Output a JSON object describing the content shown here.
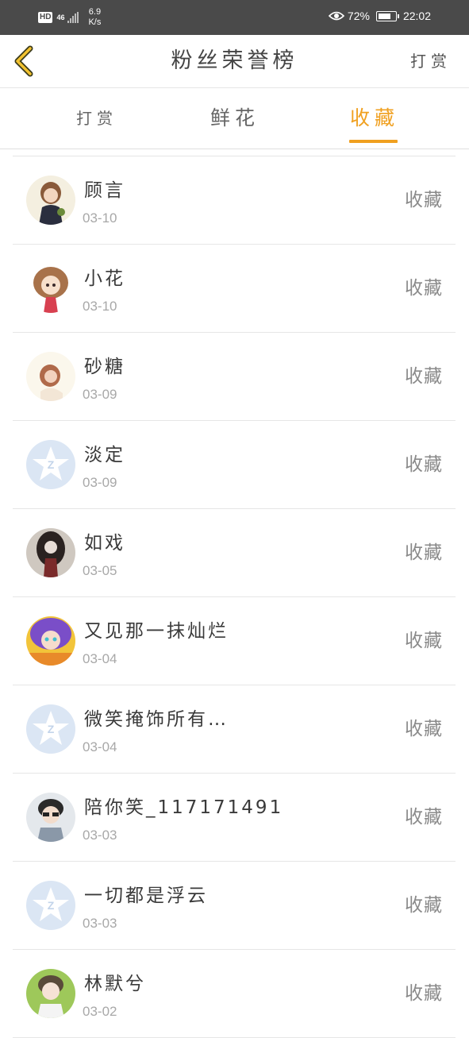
{
  "status_bar": {
    "hd_badge": "HD",
    "network": "46",
    "speed_value": "6.9",
    "speed_unit": "K/s",
    "battery": "72%",
    "time": "22:02"
  },
  "header": {
    "title": "粉丝荣誉榜",
    "action_label": "打赏"
  },
  "tabs": [
    {
      "label": "打赏",
      "active": false
    },
    {
      "label": "鲜花",
      "active": false
    },
    {
      "label": "收藏",
      "active": true
    }
  ],
  "colors": {
    "accent": "#f0a020",
    "status_bar": "#4a4a4a",
    "default_avatar": "#dbe6f4"
  },
  "entries": [
    {
      "name": "顾言",
      "date": "03-10",
      "action": "收藏",
      "avatar": "girl-brown-hair-avatar"
    },
    {
      "name": "小花",
      "date": "03-10",
      "action": "收藏",
      "avatar": "chibi-girl-avatar"
    },
    {
      "name": "砂糖",
      "date": "03-09",
      "action": "收藏",
      "avatar": "portrait-girl-avatar"
    },
    {
      "name": "淡定",
      "date": "03-09",
      "action": "收藏",
      "avatar": "default-qzone-avatar"
    },
    {
      "name": "如戏",
      "date": "03-05",
      "action": "收藏",
      "avatar": "dark-girl-avatar"
    },
    {
      "name": "又见那一抹灿烂",
      "date": "03-04",
      "action": "收藏",
      "avatar": "anime-purple-avatar"
    },
    {
      "name": "微笑掩饰所有…",
      "date": "03-04",
      "action": "收藏",
      "avatar": "default-qzone-avatar"
    },
    {
      "name": "陪你笑_117171491",
      "date": "03-03",
      "action": "收藏",
      "avatar": "boy-glasses-avatar"
    },
    {
      "name": "一切都是浮云",
      "date": "03-03",
      "action": "收藏",
      "avatar": "default-qzone-avatar"
    },
    {
      "name": "林默兮",
      "date": "03-02",
      "action": "收藏",
      "avatar": "boy-green-avatar"
    }
  ]
}
